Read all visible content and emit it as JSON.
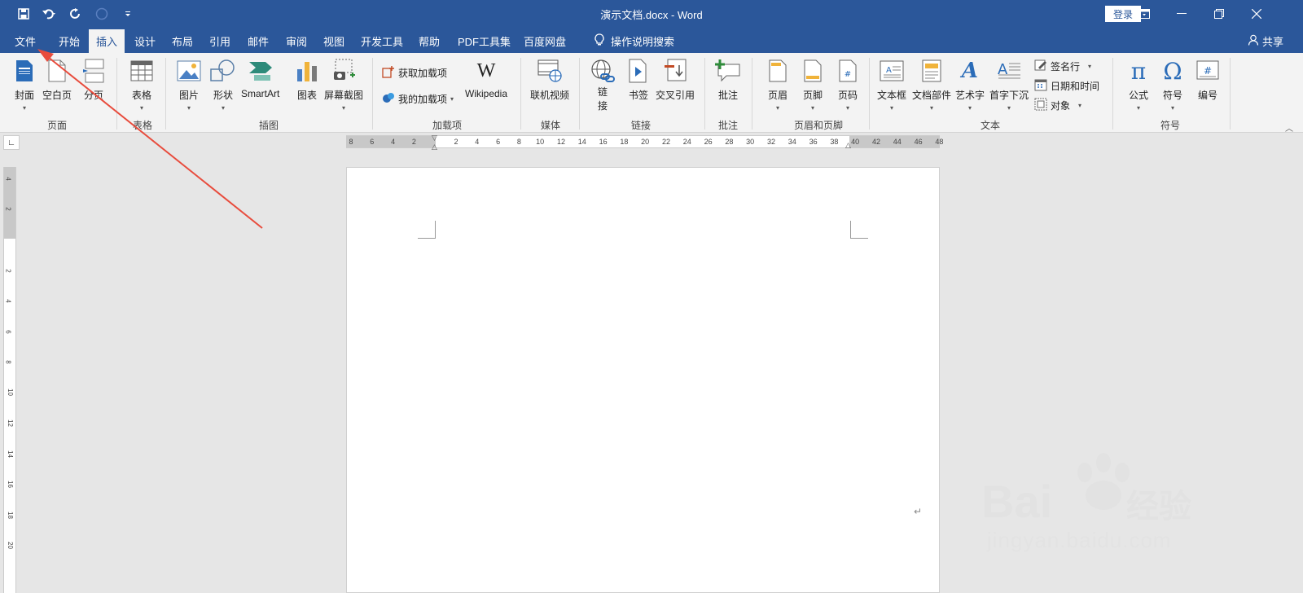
{
  "window": {
    "title": "演示文档.docx  -  Word",
    "login_label": "登录"
  },
  "tabs": [
    "文件",
    "开始",
    "插入",
    "设计",
    "布局",
    "引用",
    "邮件",
    "审阅",
    "视图",
    "开发工具",
    "帮助",
    "PDF工具集",
    "百度网盘"
  ],
  "active_tab": "插入",
  "tell_me": "操作说明搜索",
  "share_label": "共享",
  "ribbon": {
    "groups": {
      "pages": "页面",
      "tables": "表格",
      "illustrations": "插图",
      "addins": "加载项",
      "media": "媒体",
      "links": "链接",
      "comments": "批注",
      "header_footer": "页眉和页脚",
      "text": "文本",
      "symbols": "符号"
    },
    "buttons": {
      "cover": "封面",
      "blank_page": "空白页",
      "page_break": "分页",
      "table": "表格",
      "pictures": "图片",
      "shapes": "形状",
      "smartart": "SmartArt",
      "chart": "图表",
      "screenshot": "屏幕截图",
      "get_addins": "获取加载项",
      "my_addins": "我的加载项",
      "wikipedia": "Wikipedia",
      "online_video": "联机视频",
      "link_1": "链",
      "link_2": "接",
      "bookmark": "书签",
      "cross_ref": "交叉引用",
      "comment": "批注",
      "header": "页眉",
      "footer": "页脚",
      "page_number": "页码",
      "textbox": "文本框",
      "quick_parts": "文档部件",
      "wordart": "艺术字",
      "drop_cap": "首字下沉",
      "signature_line": "签名行",
      "date_time": "日期和时间",
      "object": "对象",
      "equation": "公式",
      "symbol": "符号",
      "numbering": "编号"
    }
  },
  "hruler_numbers": [
    "8",
    "6",
    "4",
    "2",
    "2",
    "4",
    "6",
    "8",
    "10",
    "12",
    "14",
    "16",
    "18",
    "20",
    "22",
    "24",
    "26",
    "28",
    "30",
    "32",
    "34",
    "36",
    "38",
    "40",
    "42",
    "44",
    "46",
    "48"
  ],
  "vruler_numbers": [
    "4",
    "2",
    "2",
    "4",
    "6",
    "8",
    "10",
    "12",
    "14",
    "16",
    "18",
    "20"
  ],
  "watermark": {
    "brand": "Bai du 经验",
    "url": "jingyan.baidu.com"
  },
  "colors": {
    "title_bar": "#2b579a",
    "ribbon_bg": "#f3f3f3",
    "annotation_arrow": "#e84c3d"
  }
}
